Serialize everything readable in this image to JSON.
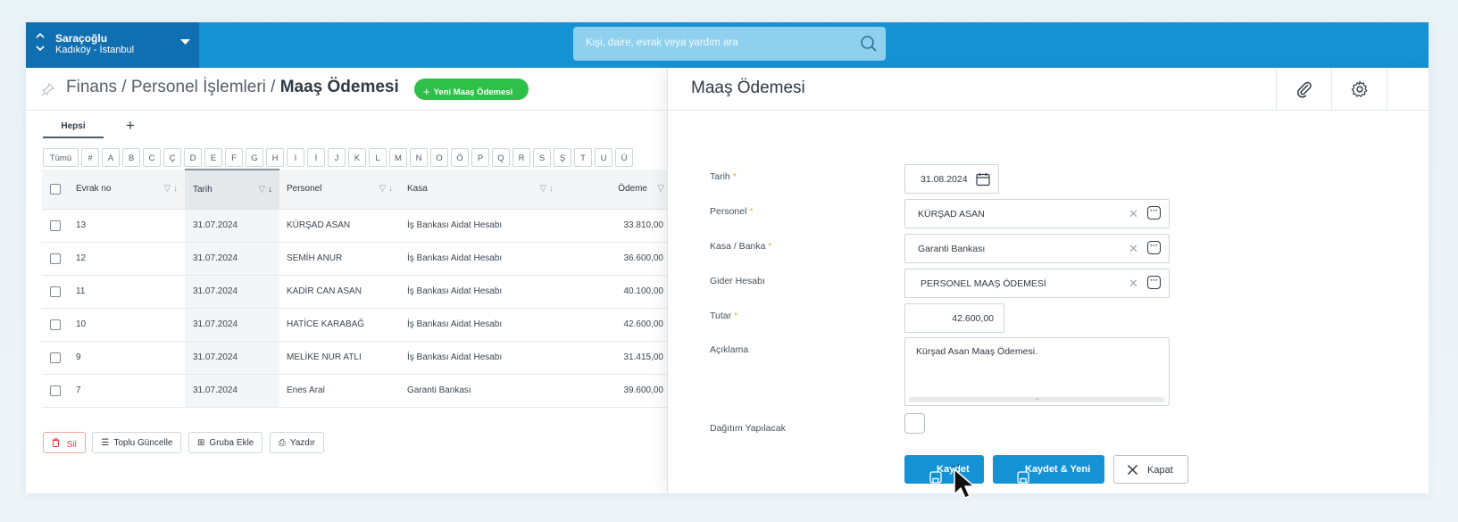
{
  "topbar": {
    "org_name": "Saraçoğlu",
    "org_location": "Kadıköy - İstanbul",
    "search_placeholder": "Kişi, daire, evrak veya yardım ara"
  },
  "list": {
    "breadcrumb_prefix": "Finans / Personel İşlemleri / ",
    "breadcrumb_current": "Maaş Ödemesi",
    "new_button": "Yeni Maaş Ödemesi",
    "tabs": [
      "Hepsi"
    ],
    "add_tab": "+",
    "letters": [
      "Tümü",
      "#",
      "A",
      "B",
      "C",
      "Ç",
      "D",
      "E",
      "F",
      "G",
      "H",
      "I",
      "İ",
      "J",
      "K",
      "L",
      "M",
      "N",
      "O",
      "Ö",
      "P",
      "Q",
      "R",
      "S",
      "Ş",
      "T",
      "U",
      "Ü"
    ],
    "columns": {
      "evrak": "Evrak no",
      "tarih": "Tarih",
      "personel": "Personel",
      "kasa": "Kasa",
      "odeme": "Ödeme"
    },
    "rows": [
      {
        "evrak": "13",
        "tarih": "31.07.2024",
        "personel": "KÜRŞAD ASAN",
        "kasa": "İş Bankası Aidat Hesabı",
        "odeme": "33.810,00"
      },
      {
        "evrak": "12",
        "tarih": "31.07.2024",
        "personel": "SEMİH ANUR",
        "kasa": "İş Bankası Aidat Hesabı",
        "odeme": "36.600,00"
      },
      {
        "evrak": "11",
        "tarih": "31.07.2024",
        "personel": "KADİR CAN ASAN",
        "kasa": "İş Bankası Aidat Hesabı",
        "odeme": "40.100,00"
      },
      {
        "evrak": "10",
        "tarih": "31.07.2024",
        "personel": "HATİCE KARABAĞ",
        "kasa": "İş Bankası Aidat Hesabı",
        "odeme": "42.600,00"
      },
      {
        "evrak": "9",
        "tarih": "31.07.2024",
        "personel": "MELİKE NUR ATLI",
        "kasa": "İş Bankası Aidat Hesabı",
        "odeme": "31.415,00"
      },
      {
        "evrak": "7",
        "tarih": "31.07.2024",
        "personel": "Enes Aral",
        "kasa": "Garanti Bankası",
        "odeme": "39.600,00"
      }
    ],
    "actions": {
      "delete": "Sil",
      "bulk_update": "Toplu Güncelle",
      "add_group": "Gruba Ekle",
      "print": "Yazdır"
    }
  },
  "form": {
    "title": "Maaş Ödemesi",
    "labels": {
      "tarih": "Tarih",
      "personel": "Personel",
      "kasa": "Kasa / Banka",
      "gider": "Gider Hesabı",
      "tutar": "Tutar",
      "aciklama": "Açıklama",
      "dagitim": "Dağıtım Yapılacak"
    },
    "required_mark": "*",
    "values": {
      "tarih": "31.08.2024",
      "personel": "KÜRŞAD ASAN",
      "kasa": "Garanti Bankası",
      "gider": "PERSONEL MAAŞ ÖDEMESİ",
      "tutar": "42.600,00",
      "aciklama": "Kürşad Asan Maaş Ödemesi."
    },
    "buttons": {
      "save": "Kaydet",
      "save_new": "Kaydet & Yeni",
      "close": "Kapat"
    }
  },
  "colors": {
    "topbar": "#1592d4",
    "org_block": "#0f6fb1",
    "new_button": "#2ec048",
    "primary": "#1592d4",
    "danger": "#e23b3b",
    "required": "#f3a82e"
  }
}
